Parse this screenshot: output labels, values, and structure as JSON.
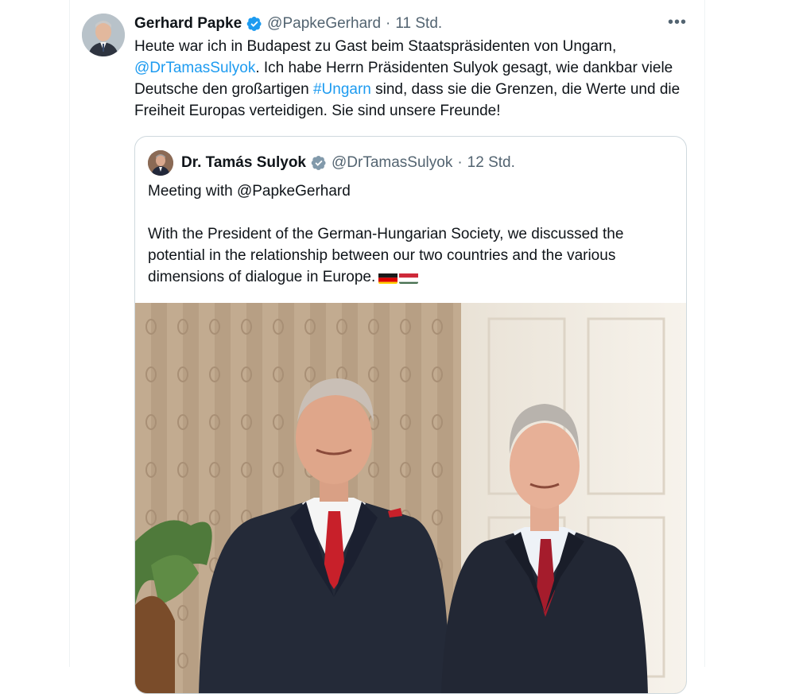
{
  "tweet": {
    "author_name": "Gerhard Papke",
    "handle": "@PapkeGerhard",
    "separator": "·",
    "time": "11 Std.",
    "more_label": "•••",
    "text_parts": {
      "p1": "Heute war ich in Budapest zu Gast beim Staatspräsidenten von Ungarn, ",
      "mention": "@DrTamasSulyok",
      "p2": ". Ich habe Herrn Präsidenten Sulyok gesagt, wie dankbar viele Deutsche den großartigen ",
      "hashtag": "#Ungarn",
      "p3": " sind, dass sie die Grenzen, die Werte und die Freiheit Europas verteidigen. Sie sind unsere Freunde!"
    },
    "icons": {
      "verified": "verified-badge-icon",
      "more": "more-options-icon"
    },
    "colors": {
      "link": "#1d9bf0",
      "verified": "#1d9bf0",
      "muted": "#536471"
    }
  },
  "quoted_tweet": {
    "author_name": "Dr. Tamás Sulyok",
    "handle": "@DrTamasSulyok",
    "separator": "·",
    "time": "12 Std.",
    "line1": "Meeting with @PapkeGerhard",
    "line2": "With the President of the German-Hungarian Society, we discussed the potential in the relationship between our two countries and the various dimensions of dialogue in Europe.",
    "flags": [
      "germany-flag-icon",
      "hungary-flag-icon"
    ],
    "verified_color": "#829aab"
  }
}
